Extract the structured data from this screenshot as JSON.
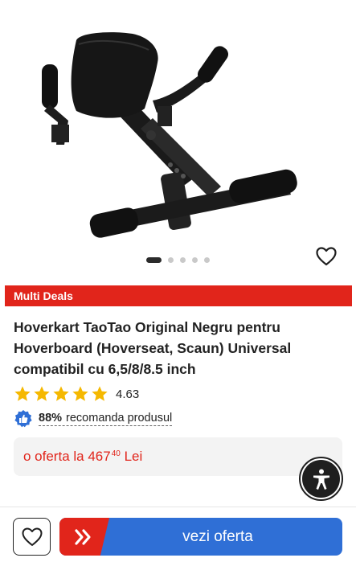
{
  "gallery": {
    "image_name": "hoverkart-product-image",
    "dots_total": 5,
    "active_dot": 0
  },
  "deal_banner": {
    "label": "Multi Deals",
    "color": "#e1251b"
  },
  "product": {
    "title": "Hoverkart TaoTao Original Negru pentru Hoverboard (Hoverseat, Scaun) Universal compatibil cu 6,5/8/8.5 inch",
    "rating": "4.63",
    "rating_stars": 5,
    "recommend_pct": "88%",
    "recommend_text": "recomanda produsul"
  },
  "offer": {
    "prefix": "o oferta la",
    "price_int": "467",
    "price_dec": "40",
    "currency": "Lei",
    "color": "#e1251b"
  },
  "bottom_bar": {
    "cta_label": "vezi oferta",
    "cta_color": "#2f6fd6",
    "cta_accent": "#e1251b"
  },
  "icons": {
    "favorite": "heart-outline-icon",
    "accessibility": "accessibility-icon",
    "recommend": "thumbs-up-badge-icon",
    "cta": "double-chevron-right-icon"
  }
}
